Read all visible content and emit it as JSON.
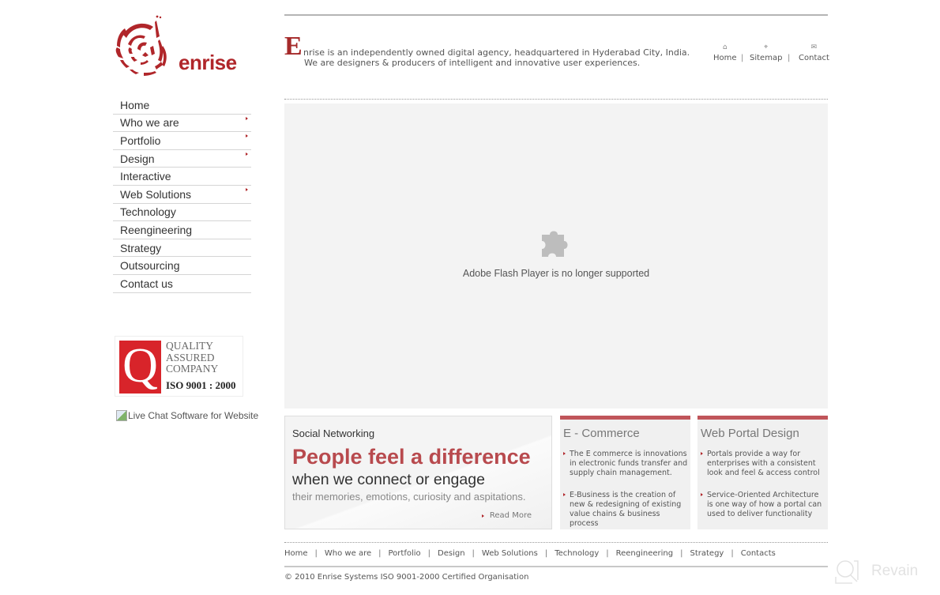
{
  "brand": {
    "name": "enrise",
    "color": "#b0262a"
  },
  "header": {
    "dropcap": "E",
    "intro_line1": "nrise is an independently owned digital agency, headquartered in Hyderabad City, India.",
    "intro_line2": "We are designers & producers of intelligent and innovative user experiences.",
    "top_links": [
      {
        "label": "Home",
        "icon": "home-icon"
      },
      {
        "label": "Sitemap",
        "icon": "sitemap-icon"
      },
      {
        "label": "Contact",
        "icon": "mail-icon"
      }
    ],
    "separator": "|"
  },
  "sidebar": {
    "items": [
      {
        "label": "Home",
        "has_submenu": false
      },
      {
        "label": "Who we are",
        "has_submenu": true
      },
      {
        "label": "Portfolio",
        "has_submenu": true
      },
      {
        "label": "Design",
        "has_submenu": true
      },
      {
        "label": "Interactive",
        "has_submenu": false
      },
      {
        "label": "Web Solutions",
        "has_submenu": true
      },
      {
        "label": "Technology",
        "has_submenu": false
      },
      {
        "label": "Reengineering",
        "has_submenu": false
      },
      {
        "label": "Strategy",
        "has_submenu": false
      },
      {
        "label": "Outsourcing",
        "has_submenu": false
      },
      {
        "label": "Contact us",
        "has_submenu": false
      }
    ],
    "iso_badge": {
      "letter": "Q",
      "line1": "QUALITY",
      "line2": "ASSURED",
      "line3": "COMPANY",
      "standard": "ISO 9001 : 2000"
    },
    "live_chat_alt": "Live Chat Software for Website"
  },
  "flash": {
    "message": "Adobe Flash Player is no longer supported",
    "icon": "plugin-puzzle-icon"
  },
  "social": {
    "title": "Social Networking",
    "headline": "People feel a difference",
    "subhead": "when we connect or engage",
    "small": "their memories, emotions, curiosity and aspitations.",
    "read_more": "Read More"
  },
  "cards": [
    {
      "title": "E - Commerce",
      "bullets": [
        "The E commerce is innovations in electronic funds transfer and supply chain management.",
        "E-Business is the creation of new & redesigning of existing value chains & business process"
      ]
    },
    {
      "title": "Web Portal Design",
      "bullets": [
        "Portals provide a way for enterprises with a consistent look and feel & access control",
        "Service-Oriented Architecture is one way of how a portal can used to deliver functionality"
      ]
    }
  ],
  "footer": {
    "links": [
      "Home",
      "Who we are",
      "Portfolio",
      "Design",
      "Web Solutions",
      "Technology",
      "Reengineering",
      "Strategy",
      "Contacts"
    ],
    "separator": "|",
    "copyright": "© 2010 Enrise Systems ISO 9001-2000 Certified Organisation"
  },
  "watermark": {
    "text": "Revain"
  },
  "colors": {
    "accent_red": "#b0262a",
    "headline_red": "#b84a4e",
    "card_top_bar": "#c0555a",
    "panel_gray": "#f3f3f3"
  }
}
